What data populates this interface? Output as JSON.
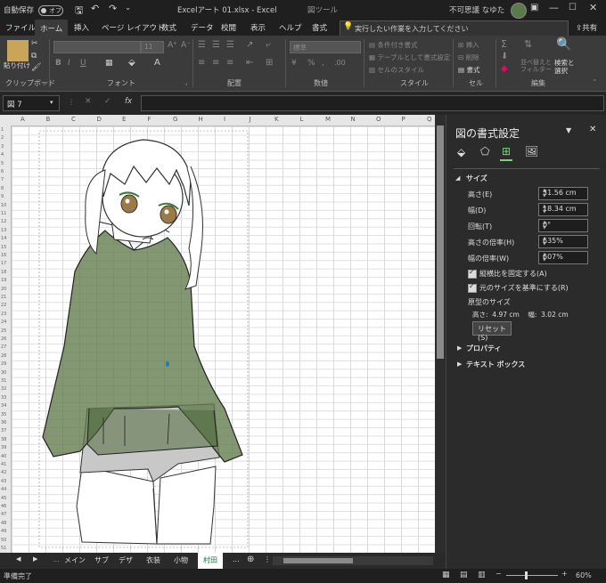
{
  "titlebar": {
    "autosave_label": "自動保存",
    "autosave_state": "オフ",
    "file_title": "Excelアート 01.xlsx  -  Excel",
    "context_tools": "図ツール",
    "user_name": "不可思議 なゆた"
  },
  "tabs": [
    "ファイル",
    "ホーム",
    "挿入",
    "ページ レイアウト",
    "数式",
    "データ",
    "校閲",
    "表示",
    "ヘルプ",
    "書式"
  ],
  "active_tab": "ホーム",
  "tell_me": "実行したい作業を入力してください",
  "share": "共有",
  "ribbon": {
    "groups": [
      "クリップボード",
      "フォント",
      "配置",
      "数値",
      "スタイル",
      "セル",
      "編集"
    ],
    "paste_label": "貼り付け",
    "font_size": "11",
    "number_format": "標準",
    "style_items": [
      "条件付き書式",
      "テーブルとして書式設定",
      "セルのスタイル"
    ],
    "cell_items": [
      "挿入",
      "削除",
      "書式"
    ],
    "edit_items": [
      "並べ替えと\nフィルター",
      "検索と\n選択"
    ]
  },
  "formula_bar": {
    "name_box": "図 7",
    "fx": "fx",
    "formula": ""
  },
  "sheet": {
    "columns": [
      "A",
      "B",
      "C",
      "D",
      "E",
      "F",
      "G",
      "H",
      "I",
      "J",
      "K",
      "L",
      "M",
      "N",
      "O",
      "P",
      "Q"
    ],
    "rows_visible": 51,
    "tabs": [
      "メイン",
      "サブ",
      "デザ",
      "衣装",
      "小物",
      "村田"
    ],
    "active_tab": "村田",
    "more": "..."
  },
  "status": {
    "ready": "準備完了",
    "zoom": "60%"
  },
  "pane": {
    "title": "図の書式設定",
    "section_size": "サイズ",
    "height_label": "高さ(E)",
    "height_value": "31.56 cm",
    "width_label": "幅(D)",
    "width_value": "18.34 cm",
    "rotation_label": "回転(T)",
    "rotation_value": "0°",
    "scale_h_label": "高さの倍率(H)",
    "scale_h_value": "635%",
    "scale_w_label": "幅の倍率(W)",
    "scale_w_value": "607%",
    "lock_aspect_label": "縦横比を固定する(A)",
    "relative_label": "元のサイズを基準にする(R)",
    "original_size_label": "原型のサイズ",
    "original_size_value": "高さ:  4.97 cm    幅:  3.02 cm",
    "reset_label": "リセット(S)",
    "section_properties": "プロパティ",
    "section_textbox": "テキスト ボックス"
  },
  "colors": {
    "accent_green": "#217346",
    "dark_bg": "#262626",
    "figure_fill": "#5f7a4a"
  }
}
